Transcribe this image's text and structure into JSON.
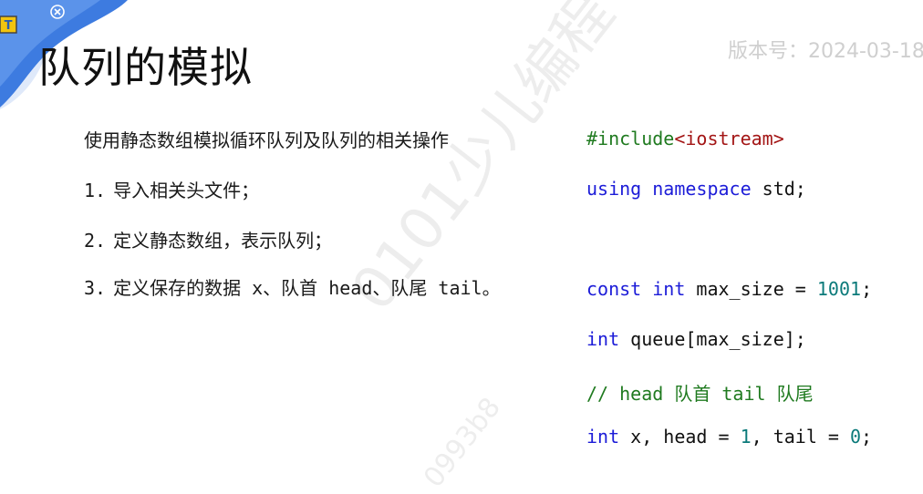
{
  "slide": {
    "title": "队列的模拟",
    "version": "版本号：2024-03-18",
    "intro": "使用静态数组模拟循环队列及队列的相关操作",
    "steps": [
      {
        "num": "1.",
        "text": "导入相关头文件；"
      },
      {
        "num": "2.",
        "text": "定义静态数组，表示队列；"
      },
      {
        "num": "3.",
        "text": "定义保存的数据 x、队首 head、队尾 tail。"
      }
    ]
  },
  "code": {
    "include_directive": "#include",
    "include_header": "<iostream>",
    "using_kw": "using",
    "namespace_kw": "namespace",
    "namespace_name": " std;",
    "const_kw": "const",
    "int_kw": "int",
    "max_size_decl": " max_size = ",
    "max_size_value": "1001",
    "semicolon": ";",
    "queue_decl": " queue[max_size];",
    "comment": "// head 队首 tail 队尾",
    "x_decl": " x, head = ",
    "head_value": "1",
    "tail_decl": ", tail = ",
    "tail_value": "0"
  },
  "watermark": {
    "main": "0101少儿编程",
    "sub": "0993b8"
  },
  "colors": {
    "keyword": "#1c1cd8",
    "preprocessor": "#1f7a1f",
    "string": "#a31515",
    "number": "#0b7a7a",
    "comment": "#1f7a1f",
    "corner_blue": "#3d7be0"
  },
  "icons": {
    "corner_logo": "logo-t-icon",
    "close": "close-circle-icon"
  }
}
